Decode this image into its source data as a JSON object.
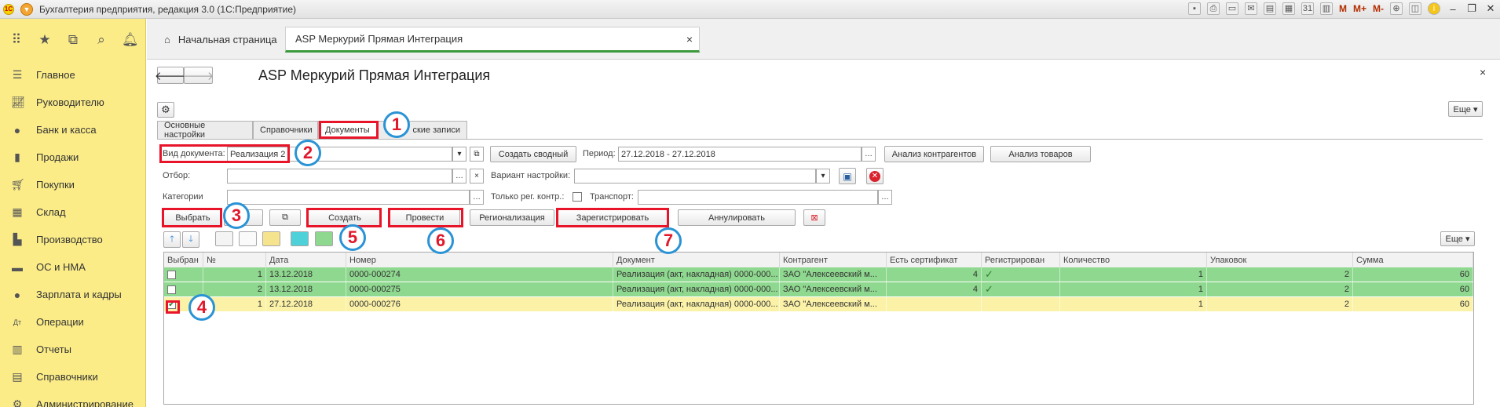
{
  "window": {
    "title": "Бухгалтерия предприятия, редакция 3.0  (1С:Предприятие)"
  },
  "toolbar": {
    "m": "M",
    "mplus": "M+",
    "mminus": "M-"
  },
  "sidebar": {
    "items": [
      {
        "label": "Главное",
        "icon": "menu-icon"
      },
      {
        "label": "Руководителю",
        "icon": "chart-icon"
      },
      {
        "label": "Банк и касса",
        "icon": "bank-icon"
      },
      {
        "label": "Продажи",
        "icon": "bag-icon"
      },
      {
        "label": "Покупки",
        "icon": "cart-icon"
      },
      {
        "label": "Склад",
        "icon": "warehouse-icon"
      },
      {
        "label": "Производство",
        "icon": "factory-icon"
      },
      {
        "label": "ОС и НМА",
        "icon": "truck-icon"
      },
      {
        "label": "Зарплата и кадры",
        "icon": "person-icon"
      },
      {
        "label": "Операции",
        "icon": "operations-icon"
      },
      {
        "label": "Отчеты",
        "icon": "chart-bar-icon"
      },
      {
        "label": "Справочники",
        "icon": "book-icon"
      },
      {
        "label": "Администрирование",
        "icon": "gear-icon"
      }
    ]
  },
  "tabs": {
    "home": "Начальная страница",
    "active": "ASP Меркурий Прямая Интеграция",
    "close": "×"
  },
  "form": {
    "title": "ASP Меркурий Прямая Интеграция",
    "more": "Еще ▾",
    "close": "×",
    "inner_tabs": [
      "Основные настройки",
      "Справочники",
      "Документы",
      "ские записи"
    ],
    "doc_type_label": "Вид документа:",
    "doc_type_value": "Реализация 2",
    "create_summary": "Создать сводный",
    "period_label": "Период:",
    "period_value": "27.12.2018 - 27.12.2018",
    "analysis_contractors": "Анализ контрагентов",
    "analysis_goods": "Анализ товаров",
    "filter_label": "Отбор:",
    "variant_label": "Вариант настройки:",
    "categories_label": "Категории",
    "only_reg_label": "Только рег. контр.:",
    "transport_label": "Транспорт:",
    "buttons": {
      "select": "Выбрать",
      "create": "Создать",
      "post": "Провести",
      "regionalize": "Регионализация",
      "register": "Зарегистрировать",
      "annul": "Аннулировать"
    },
    "grid_more": "Еще ▾"
  },
  "grid": {
    "columns": [
      "Выбран",
      "№",
      "Дата",
      "Номер",
      "Документ",
      "Контрагент",
      "Есть сертификат",
      "Регистрирован",
      "Количество",
      "Упаковок",
      "Сумма"
    ],
    "rows": [
      {
        "checked": false,
        "n": "1",
        "date": "13.12.2018",
        "number": "0000-000274",
        "doc": "Реализация (акт, накладная) 0000-000...",
        "contractor": "ЗАО \"Алексеевский м...",
        "cert": "4",
        "registered": "✓",
        "qty": "1",
        "packs": "2",
        "sum": "60"
      },
      {
        "checked": false,
        "n": "2",
        "date": "13.12.2018",
        "number": "0000-000275",
        "doc": "Реализация (акт, накладная) 0000-000...",
        "contractor": "ЗАО \"Алексеевский м...",
        "cert": "4",
        "registered": "✓",
        "qty": "1",
        "packs": "2",
        "sum": "60"
      },
      {
        "checked": true,
        "n": "1",
        "date": "27.12.2018",
        "number": "0000-000276",
        "doc": "Реализация (акт, накладная) 0000-000...",
        "contractor": "ЗАО \"Алексеевский м...",
        "cert": "",
        "registered": "",
        "qty": "1",
        "packs": "2",
        "sum": "60"
      }
    ]
  },
  "markers": [
    "1",
    "2",
    "3",
    "4",
    "5",
    "6",
    "7"
  ],
  "colors": {
    "sidebar": "#fbec88",
    "row_green": "#8fd88f",
    "row_yellow": "#fbf2a8",
    "marker_ring": "#2a93d5",
    "highlight": "#e8142a"
  }
}
